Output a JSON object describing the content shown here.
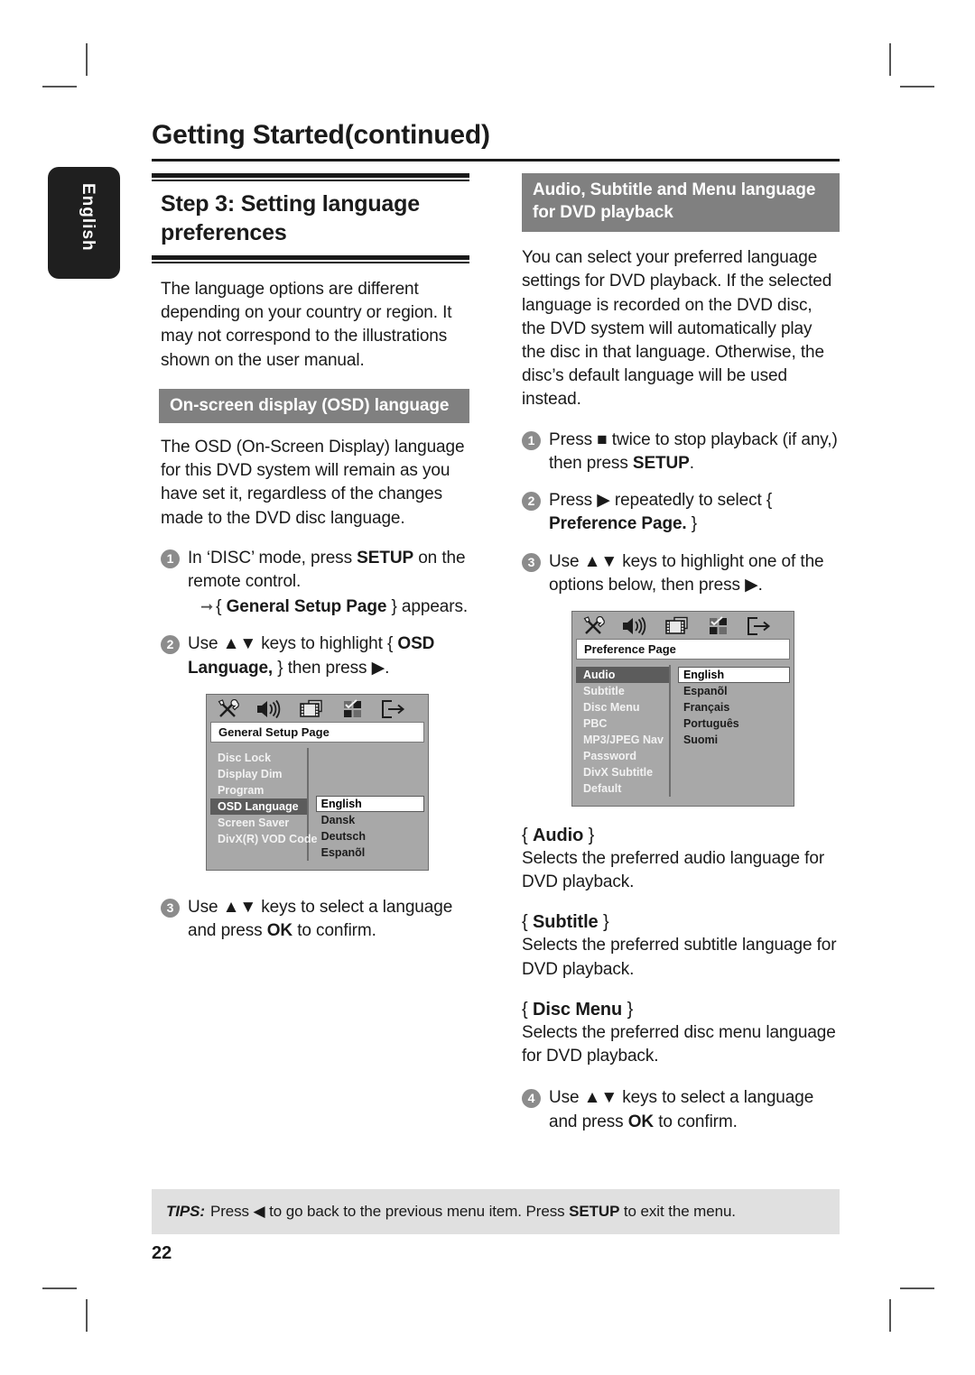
{
  "page": {
    "header_title": "Getting Started",
    "header_continued": "(continued)",
    "side_tab": "English",
    "page_number": "22"
  },
  "left_column": {
    "step_title": "Step 3:  Setting language preferences",
    "intro": "The language options are different depending on your country or region.  It may not correspond to the illustrations shown on the user manual.",
    "osd_heading": "On-screen display (OSD) language",
    "osd_paragraph": "The OSD (On-Screen Display) language for this DVD system will remain as you have set it, regardless of the changes made to the DVD disc language.",
    "steps": [
      {
        "num": "1",
        "text_before": "In ‘DISC’ mode, press ",
        "bold": "SETUP",
        "text_after": " on the remote control.",
        "sub_arrow_before": "{ ",
        "sub_arrow_bold": "General Setup Page",
        "sub_arrow_after": " } appears."
      },
      {
        "num": "2",
        "text_before": "Use ▲▼ keys to highlight { ",
        "bold": "OSD Language,",
        "text_after": " } then press ▶."
      },
      {
        "num": "3",
        "text_before": "Use ▲▼ keys to select a language and press ",
        "bold": "OK",
        "text_after": " to confirm."
      }
    ],
    "osd_menu": {
      "page_title": "General Setup Page",
      "items": [
        "Disc Lock",
        "Display Dim",
        "Program",
        "OSD Language",
        "Screen Saver",
        "DivX(R) VOD Code"
      ],
      "selected_item": "OSD Language",
      "values": [
        "English",
        "Dansk",
        "Deutsch",
        "Espanõl"
      ],
      "selected_value": "English",
      "icons": [
        "tools-icon",
        "speaker-icon",
        "film-icon",
        "checkbox-grid-icon",
        "exit-icon"
      ]
    }
  },
  "right_column": {
    "heading": "Audio, Subtitle and Menu language for DVD playback",
    "intro": "You can select your preferred language settings for DVD playback.  If the selected language is recorded on the DVD disc, the DVD system will automatically play the disc in that language.  Otherwise, the disc’s default language will be used instead.",
    "steps": [
      {
        "num": "1",
        "text_before": "Press ■ twice to stop playback (if any,) then press ",
        "bold": "SETUP",
        "text_after": "."
      },
      {
        "num": "2",
        "text_before": "Press ▶ repeatedly to select { ",
        "bold": "Preference Page.",
        "text_after": " }"
      },
      {
        "num": "3",
        "text_before": "Use ▲▼ keys to highlight one of the options below, then press ▶.",
        "bold": "",
        "text_after": ""
      }
    ],
    "osd_menu": {
      "page_title": "Preference Page",
      "items": [
        "Audio",
        "Subtitle",
        "Disc Menu",
        "PBC",
        "MP3/JPEG Nav",
        "Password",
        "DivX Subtitle",
        "Default"
      ],
      "selected_item": "Audio",
      "values": [
        "English",
        "Espanõl",
        "Français",
        "Português",
        "Suomi"
      ],
      "selected_value": "English",
      "icons": [
        "tools-icon",
        "speaker-icon",
        "film-icon",
        "checkbox-grid-icon",
        "exit-icon"
      ]
    },
    "options": [
      {
        "title_open": "{ ",
        "title_bold": "Audio",
        "title_close": " }",
        "desc": "Selects the preferred audio language for DVD playback."
      },
      {
        "title_open": "{ ",
        "title_bold": "Subtitle",
        "title_close": " }",
        "desc": "Selects the preferred subtitle language for DVD playback."
      },
      {
        "title_open": "{ ",
        "title_bold": "Disc Menu",
        "title_close": " }",
        "desc": "Selects the preferred disc menu language for DVD playback."
      }
    ],
    "final_step": {
      "num": "4",
      "text_before": "Use ▲▼ keys to select a language and press ",
      "bold": "OK",
      "text_after": " to confirm."
    }
  },
  "tips": {
    "label": "TIPS:",
    "text_before": "Press ◀ to go back to the previous menu item.  Press ",
    "bold": "SETUP",
    "text_after": " to exit the menu."
  },
  "colors": {
    "gray_bar": "#808080",
    "tips_bg": "#e0e0e0",
    "osd_bg": "#a8a8a8",
    "osd_selected": "#5c5c5c",
    "tab_bg": "#1f1f1f"
  }
}
